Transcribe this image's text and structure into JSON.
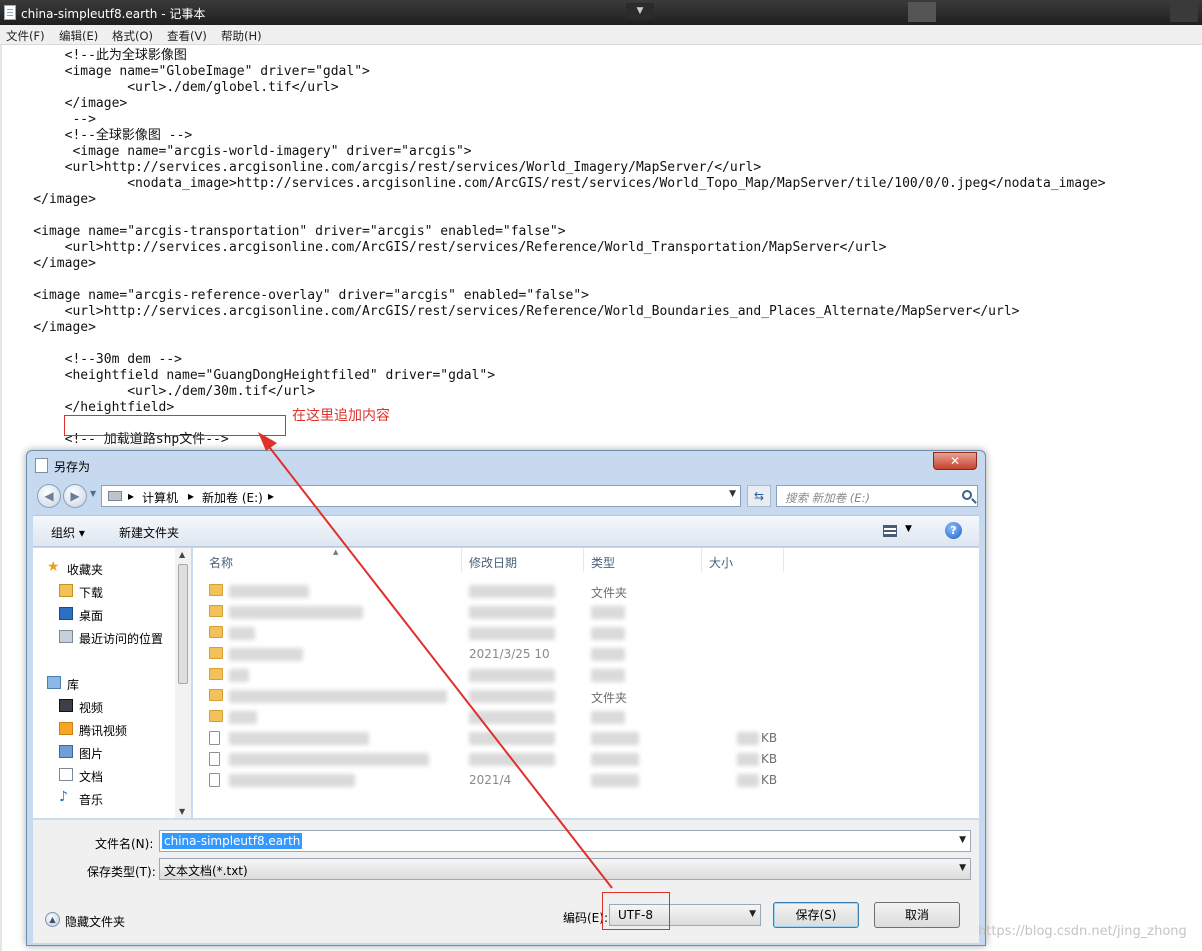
{
  "notepad": {
    "title": "china-simpleutf8.earth - 记事本",
    "menu": [
      "文件(F)",
      "编辑(E)",
      "格式(O)",
      "查看(V)",
      "帮助(H)"
    ],
    "code_lines": [
      "        <!--此为全球影像图",
      "        <image name=\"GlobeImage\" driver=\"gdal\">",
      "                <url>./dem/globel.tif</url>",
      "        </image>",
      "         -->",
      "        <!--全球影像图 -->",
      "         <image name=\"arcgis-world-imagery\" driver=\"arcgis\">",
      "        <url>http://services.arcgisonline.com/arcgis/rest/services/World_Imagery/MapServer/</url>",
      "                <nodata_image>http://services.arcgisonline.com/ArcGIS/rest/services/World_Topo_Map/MapServer/tile/100/0/0.jpeg</nodata_image>",
      "    </image>",
      "",
      "    <image name=\"arcgis-transportation\" driver=\"arcgis\" enabled=\"false\">",
      "        <url>http://services.arcgisonline.com/ArcGIS/rest/services/Reference/World_Transportation/MapServer</url>",
      "    </image>",
      "",
      "    <image name=\"arcgis-reference-overlay\" driver=\"arcgis\" enabled=\"false\">",
      "        <url>http://services.arcgisonline.com/ArcGIS/rest/services/Reference/World_Boundaries_and_Places_Alternate/MapServer</url>",
      "    </image>",
      "",
      "        <!--30m dem -->",
      "        <heightfield name=\"GuangDongHeightfiled\" driver=\"gdal\">",
      "                <url>./dem/30m.tif</url>",
      "        </heightfield>",
      "",
      "        <!-- 加载道路shp文件-->"
    ]
  },
  "annotation": {
    "note": "在这里追加内容",
    "color": "#e0302c"
  },
  "dialog": {
    "title": "另存为",
    "close_label": "✕",
    "address": {
      "segments": [
        "计算机",
        "新加卷 (E:)"
      ],
      "search_placeholder": "搜索 新加卷 (E:)"
    },
    "toolbar": {
      "organize": "组织 ▾",
      "new_folder": "新建文件夹"
    },
    "nav": {
      "favorites": "收藏夹",
      "favorites_items": [
        "下载",
        "桌面",
        "最近访问的位置"
      ],
      "libraries": "库",
      "library_items": [
        "视频",
        "腾讯视频",
        "图片",
        "文档",
        "音乐"
      ]
    },
    "columns": [
      "名称",
      "修改日期",
      "类型",
      "大小"
    ],
    "files": {
      "visible_types": [
        "文件夹",
        "文件夹"
      ],
      "visible_dates": [
        "2021/3/25 10",
        "2021/4"
      ],
      "visible_sizes": [
        "KB",
        "KB",
        "KB"
      ]
    },
    "filename_label": "文件名(N):",
    "filename_value": "china-simpleutf8.earth",
    "savetype_label": "保存类型(T):",
    "savetype_value": "文本文档(*.txt)",
    "encoding_label": "编码(E):",
    "encoding_value": "UTF-8",
    "hide_folders": "隐藏文件夹",
    "save_button": "保存(S)",
    "cancel_button": "取消"
  },
  "watermark": "https://blog.csdn.net/jing_zhong"
}
